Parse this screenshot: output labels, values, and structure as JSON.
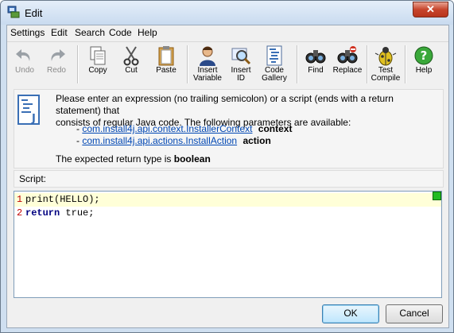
{
  "window": {
    "title": "Edit",
    "close_glyph": "✕"
  },
  "menu": [
    {
      "label": "Settings"
    },
    {
      "label": "Edit"
    },
    {
      "label": "Search"
    },
    {
      "label": "Code"
    },
    {
      "label": "Help"
    }
  ],
  "toolbar": {
    "undo": {
      "label": "Undo",
      "icon": "undo-arrow-icon",
      "enabled": false
    },
    "redo": {
      "label": "Redo",
      "icon": "redo-arrow-icon",
      "enabled": false
    },
    "copy": {
      "label": "Copy",
      "icon": "copy-icon"
    },
    "cut": {
      "label": "Cut",
      "icon": "scissors-icon"
    },
    "paste": {
      "label": "Paste",
      "icon": "clipboard-icon"
    },
    "insert_variable": {
      "label1": "Insert",
      "label2": "Variable",
      "icon": "user-icon"
    },
    "insert_id": {
      "label1": "Insert",
      "label2": "ID",
      "icon": "magnifier-icon"
    },
    "code_gallery": {
      "label1": "Code",
      "label2": "Gallery",
      "icon": "code-gallery-icon"
    },
    "find": {
      "label": "Find",
      "icon": "binoculars-icon"
    },
    "replace": {
      "label": "Replace",
      "icon": "binoculars-replace-icon"
    },
    "test_compile": {
      "label1": "Test",
      "label2": "Compile",
      "icon": "bug-icon"
    },
    "help": {
      "label": "Help",
      "icon": "help-icon"
    }
  },
  "info": {
    "line1": "Please enter an expression (no trailing semicolon) or a script (ends with a return statement) that",
    "line2": "consists of regular Java code. The following parameters are available:",
    "params": [
      {
        "dash": "-",
        "type": "com.install4j.api.context.InstallerContext",
        "name": "context"
      },
      {
        "dash": "-",
        "type": "com.install4j.api.actions.InstallAction",
        "name": "action"
      }
    ],
    "return_prefix": "The expected return type is",
    "return_type": "boolean"
  },
  "script": {
    "label": "Script:",
    "lines": [
      {
        "num": "1",
        "code": "print(HELLO);"
      },
      {
        "num": "2",
        "keyword": "return",
        "rest": " true;"
      }
    ]
  },
  "buttons": {
    "ok": "OK",
    "cancel": "Cancel"
  }
}
